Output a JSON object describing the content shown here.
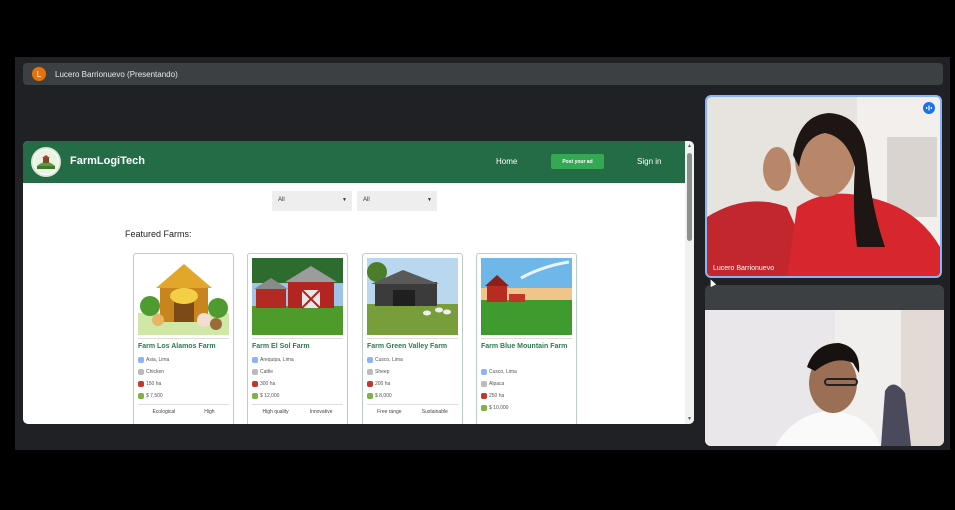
{
  "presenter_bar": {
    "avatar_initial": "L",
    "text": "Lucero Barrionuevo (Presentando)"
  },
  "site": {
    "brand": "FarmLogiTech",
    "nav": {
      "home": "Home",
      "post": "Post your ad",
      "signin": "Sign in"
    },
    "filters": {
      "first": "All",
      "second": "All"
    },
    "featured_title": "Featured Farms:",
    "farms": [
      {
        "title": "Farm Los Alamos Farm",
        "location": "Asia, Lima",
        "animal": "Chicken",
        "area": "150 ha",
        "price": "$ 7,500",
        "tag1": "Ecological",
        "tag2": "High"
      },
      {
        "title": "Farm El Sol Farm",
        "location": "Arequipa, Lima",
        "animal": "Cattle",
        "area": "300 ha",
        "price": "$ 12,000",
        "tag1": "High quality",
        "tag2": "Innovative"
      },
      {
        "title": "Farm Green Valley Farm",
        "location": "Cusco, Lima",
        "animal": "Sheep",
        "area": "200 ha",
        "price": "$ 8,000",
        "tag1": "Free range",
        "tag2": "Sustainable"
      },
      {
        "title": "Farm Blue Mountain Farm",
        "location": "Cusco, Lima",
        "animal": "Alpaca",
        "area": "250 ha",
        "price": "$ 10,000",
        "tag1": "",
        "tag2": ""
      }
    ]
  },
  "participants": {
    "first_name": "Lucero Barrionuevo"
  },
  "colors": {
    "navbar": "#236c46",
    "accent_button": "#34a853",
    "card_title": "#2b7a4f",
    "active_tile_border": "#8ab4f8"
  }
}
